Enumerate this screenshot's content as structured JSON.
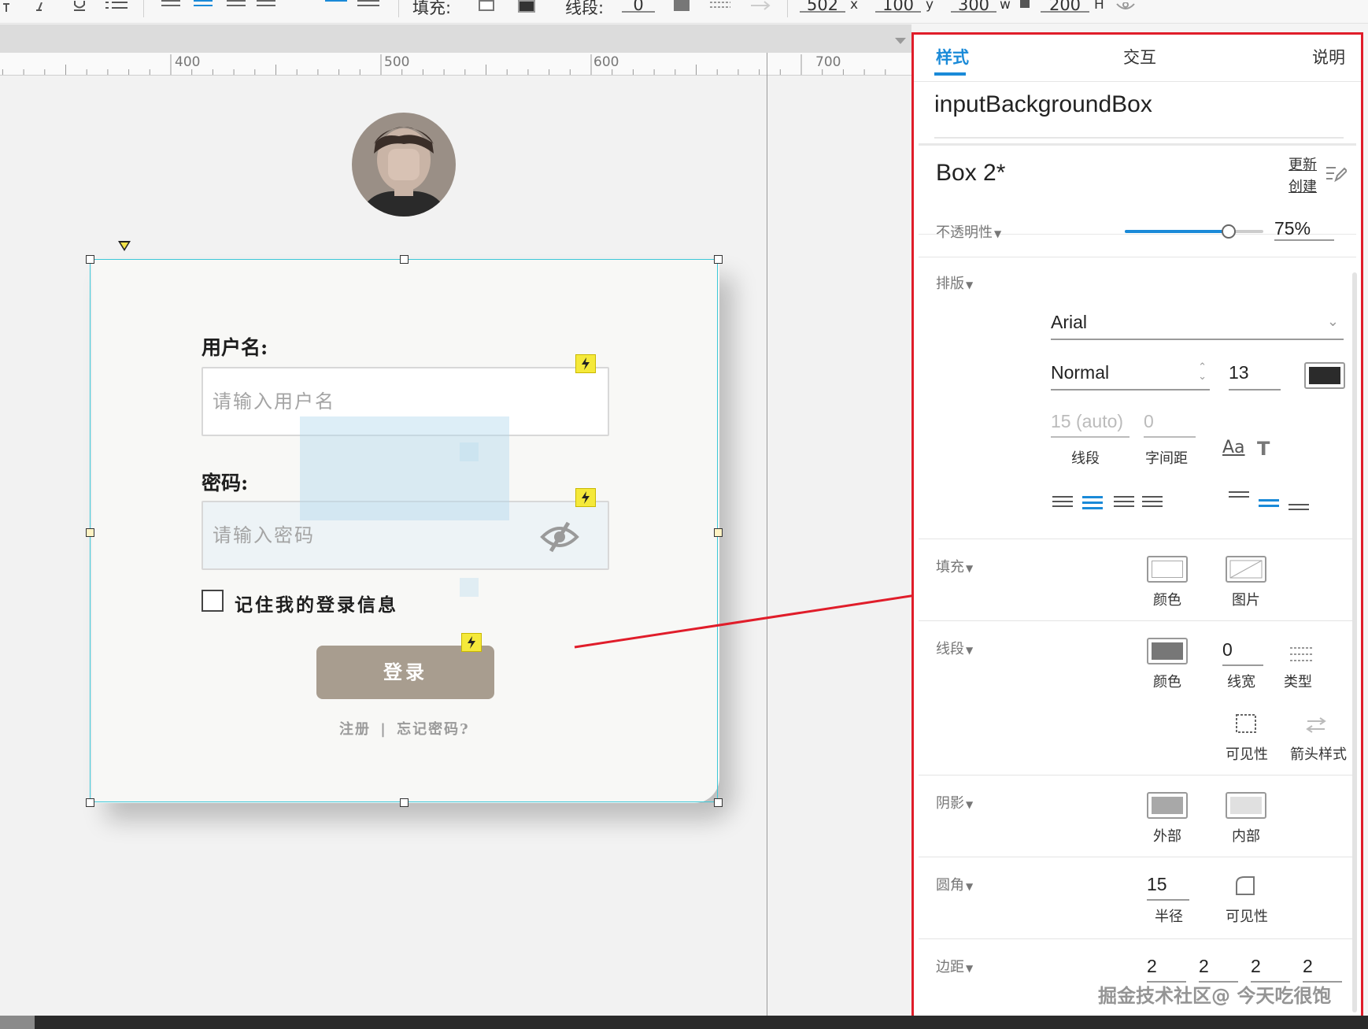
{
  "toolbar": {
    "fill_label": "填充:",
    "line_label": "线段:",
    "line_value": "0",
    "x_value": "502",
    "x_axis": "x",
    "y_value": "100",
    "y_axis": "y",
    "w_value": "300",
    "w_axis": "w",
    "h_value": "200",
    "h_axis": "H"
  },
  "ruler": {
    "ticks": [
      "400",
      "500",
      "600",
      "700"
    ]
  },
  "form": {
    "username_label": "用户名:",
    "username_placeholder": "请输入用户名",
    "password_label": "密码:",
    "password_placeholder": "请输入密码",
    "remember_label": "记住我的登录信息",
    "login_button": "登录",
    "register_link": "注册",
    "link_separator": "|",
    "forgot_link": "忘记密码?"
  },
  "panel": {
    "tabs": [
      {
        "label": "样式",
        "active": true
      },
      {
        "label": "交互",
        "active": false
      },
      {
        "label": "说明",
        "active": false
      }
    ],
    "element_name": "inputBackgroundBox",
    "style_name": "Box 2*",
    "update_link": "更新",
    "create_link": "创建",
    "opacity": {
      "label": "不透明性",
      "value": "75%",
      "level": 0.75
    },
    "typography": {
      "label": "排版",
      "font": "Arial",
      "weight": "Normal",
      "size": "13",
      "color": "#2b2b2b",
      "line_height": "15 (auto)",
      "letter_spacing": "0",
      "line_height_label": "线段",
      "letter_spacing_label": "字间距"
    },
    "fill": {
      "label": "填充",
      "color_label": "颜色",
      "image_label": "图片"
    },
    "border": {
      "label": "线段",
      "color_label": "颜色",
      "width": "0",
      "width_label": "线宽",
      "type_label": "类型",
      "visibility_label": "可见性",
      "arrow_label": "箭头样式",
      "color": "#777777"
    },
    "shadow": {
      "label": "阴影",
      "outer_label": "外部",
      "inner_label": "内部"
    },
    "corner": {
      "label": "圆角",
      "radius": "15",
      "radius_label": "半径",
      "visibility_label": "可见性"
    },
    "padding": {
      "label": "边距",
      "values": [
        "2",
        "2",
        "2",
        "2"
      ]
    }
  },
  "watermark": "掘金技术社区@ 今天吃很饱",
  "colors": {
    "accent_blue": "#1a8ad8",
    "highlight_red": "#e01d2a",
    "selection_cyan": "#3cc8d8",
    "login_button": "#a89d8f"
  }
}
